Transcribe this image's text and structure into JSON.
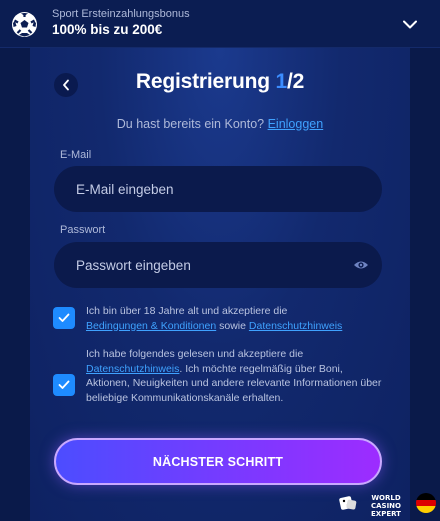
{
  "promo": {
    "subtitle": "Sport Ersteinzahlungsbonus",
    "headline": "100% bis zu 200€",
    "icon": "soccer-ball-icon"
  },
  "form": {
    "title_main": "Registrierung ",
    "title_step": "1",
    "title_total": "/2",
    "login_prompt": "Du hast bereits ein Konto?",
    "login_link": "Einloggen",
    "email_label": "E-Mail",
    "email_placeholder": "E-Mail eingeben",
    "email_value": "",
    "password_label": "Passwort",
    "password_placeholder": "Passwort eingeben",
    "password_value": "",
    "consent1": {
      "checked": true,
      "text_before": "Ich bin über 18 Jahre alt und akzeptiere die",
      "link1": "Bedingungen & Konditionen",
      "text_mid": "sowie",
      "link2": "Datenschutzhinweis"
    },
    "consent2": {
      "checked": true,
      "text_before": "Ich habe folgendes gelesen und akzeptiere die",
      "link1": "Datenschutzhinweis",
      "text_after": ". Ich möchte regelmäßig über Boni, Aktionen, Neuigkeiten und andere relevante Informationen über beliebige Kommunikationskanäle erhalten."
    },
    "next_button": "NÄCHSTER SCHRITT"
  },
  "watermark": {
    "line1": "WORLD",
    "line2": "CASINO EXPERT"
  },
  "colors": {
    "accent": "#3b8cff",
    "link": "#3fa2ff",
    "checkbox": "#1e8bff",
    "button_start": "#4c4dff",
    "button_end": "#9d2cff"
  }
}
